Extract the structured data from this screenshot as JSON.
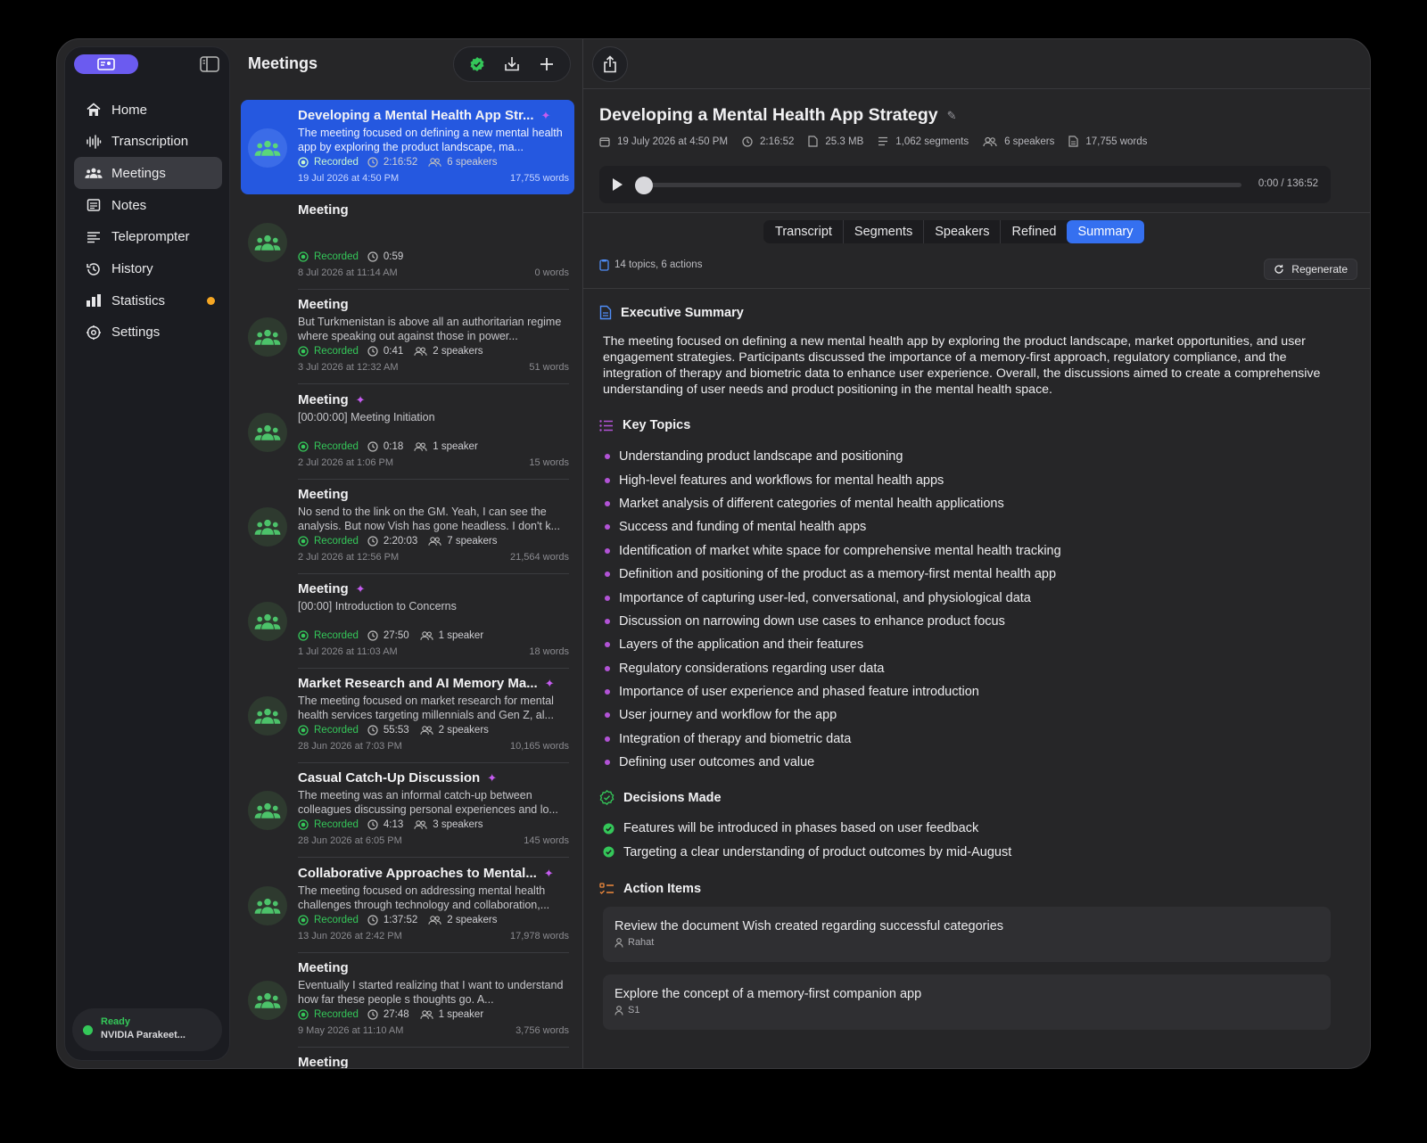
{
  "sidebar": {
    "nav": [
      {
        "label": "Home",
        "icon": "home-icon"
      },
      {
        "label": "Transcription",
        "icon": "waveform-icon"
      },
      {
        "label": "Meetings",
        "icon": "people-icon",
        "active": true
      },
      {
        "label": "Notes",
        "icon": "notes-icon"
      },
      {
        "label": "Teleprompter",
        "icon": "teleprompter-icon"
      },
      {
        "label": "History",
        "icon": "history-icon"
      },
      {
        "label": "Statistics",
        "icon": "chart-icon",
        "badge_color": "#f5a623"
      },
      {
        "label": "Settings",
        "icon": "gear-icon"
      }
    ],
    "status": {
      "title": "Ready",
      "model": "NVIDIA Parakeet..."
    }
  },
  "list": {
    "title": "Meetings",
    "items": [
      {
        "title": "Developing a Mental Health App Str...",
        "ai": true,
        "desc": "The meeting focused on defining a new mental health app by exploring the product landscape, ma...",
        "status": "Recorded",
        "duration": "2:16:52",
        "speakers": "6 speakers",
        "date": "19 Jul 2026 at 4:50 PM",
        "words": "17,755 words"
      },
      {
        "title": "Meeting",
        "ai": false,
        "desc": "",
        "status": "Recorded",
        "duration": "0:59",
        "speakers": "",
        "date": "8 Jul 2026 at 11:14 AM",
        "words": "0 words"
      },
      {
        "title": "Meeting",
        "ai": false,
        "desc": "But Turkmenistan is above all an authoritarian regime where speaking out against those in power...",
        "status": "Recorded",
        "duration": "0:41",
        "speakers": "2 speakers",
        "date": "3 Jul 2026 at 12:32 AM",
        "words": "51 words"
      },
      {
        "title": "Meeting",
        "ai": true,
        "desc": "[00:00:00] Meeting Initiation",
        "status": "Recorded",
        "duration": "0:18",
        "speakers": "1 speaker",
        "date": "2 Jul 2026 at 1:06 PM",
        "words": "15 words"
      },
      {
        "title": "Meeting",
        "ai": false,
        "desc": "No send to the link on the GM. Yeah, I can see the analysis. But now Vish has gone headless. I don't k...",
        "status": "Recorded",
        "duration": "2:20:03",
        "speakers": "7 speakers",
        "date": "2 Jul 2026 at 12:56 PM",
        "words": "21,564 words"
      },
      {
        "title": "Meeting",
        "ai": true,
        "desc": "[00:00] Introduction to Concerns",
        "status": "Recorded",
        "duration": "27:50",
        "speakers": "1 speaker",
        "date": "1 Jul 2026 at 11:03 AM",
        "words": "18 words"
      },
      {
        "title": "Market Research and AI Memory Ma...",
        "ai": true,
        "desc": "The meeting focused on market research for mental health services targeting millennials and Gen Z, al...",
        "status": "Recorded",
        "duration": "55:53",
        "speakers": "2 speakers",
        "date": "28 Jun 2026 at 7:03 PM",
        "words": "10,165 words"
      },
      {
        "title": "Casual Catch-Up Discussion",
        "ai": true,
        "desc": "The meeting was an informal catch-up between colleagues discussing personal experiences and lo...",
        "status": "Recorded",
        "duration": "4:13",
        "speakers": "3 speakers",
        "date": "28 Jun 2026 at 6:05 PM",
        "words": "145 words"
      },
      {
        "title": "Collaborative Approaches to Mental...",
        "ai": true,
        "desc": "The meeting focused on addressing mental health challenges through technology and collaboration,...",
        "status": "Recorded",
        "duration": "1:37:52",
        "speakers": "2 speakers",
        "date": "13 Jun 2026 at 2:42 PM",
        "words": "17,978 words"
      },
      {
        "title": "Meeting",
        "ai": false,
        "desc": "Eventually I started realizing that I want to understand how far these people s thoughts go. A...",
        "status": "Recorded",
        "duration": "27:48",
        "speakers": "1 speaker",
        "date": "9 May 2026 at 11:10 AM",
        "words": "3,756 words"
      },
      {
        "title": "Meeting",
        "ai": false,
        "desc": "",
        "status": "",
        "duration": "",
        "speakers": "",
        "date": "",
        "words": ""
      }
    ]
  },
  "detail": {
    "title": "Developing a Mental Health App Strategy",
    "meta": {
      "date": "19 July 2026 at 4:50 PM",
      "duration": "2:16:52",
      "size": "25.3 MB",
      "segments": "1,062 segments",
      "speakers": "6 speakers",
      "words": "17,755 words"
    },
    "player": {
      "time": "0:00 / 136:52",
      "progress": 0
    },
    "tabs": [
      "Transcript",
      "Segments",
      "Speakers",
      "Refined",
      "Summary"
    ],
    "active_tab": "Summary",
    "summary_stats": "14 topics, 6 actions",
    "regenerate": "Regenerate",
    "exec_title": "Executive Summary",
    "exec_text": "The meeting focused on defining a new mental health app by exploring the product landscape, market opportunities, and user engagement strategies. Participants discussed the importance of a memory-first approach, regulatory compliance, and the integration of therapy and biometric data to enhance user experience. Overall, the discussions aimed to create a comprehensive understanding of user needs and product positioning in the mental health space.",
    "topics_title": "Key Topics",
    "topics": [
      "Understanding product landscape and positioning",
      "High-level features and workflows for mental health apps",
      "Market analysis of different categories of mental health applications",
      "Success and funding of mental health apps",
      "Identification of market white space for comprehensive mental health tracking",
      "Definition and positioning of the product as a memory-first mental health app",
      "Importance of capturing user-led, conversational, and physiological data",
      "Discussion on narrowing down use cases to enhance product focus",
      "Layers of the application and their features",
      "Regulatory considerations regarding user data",
      "Importance of user experience and phased feature introduction",
      "User journey and workflow for the app",
      "Integration of therapy and biometric data",
      "Defining user outcomes and value"
    ],
    "decisions_title": "Decisions Made",
    "decisions": [
      "Features will be introduced in phases based on user feedback",
      "Targeting a clear understanding of product outcomes by mid-August"
    ],
    "actions_title": "Action Items",
    "actions": [
      {
        "title": "Review the document Wish created regarding successful categories",
        "owner": "Rahat"
      },
      {
        "title": "Explore the concept of a memory-first companion app",
        "owner": "S1"
      }
    ]
  },
  "colors": {
    "accent": "#3570f0",
    "selected_row": "#2558e0",
    "recorded": "#34c759",
    "ai_spark": "#c55cf0",
    "profile": "#6b5bf0"
  }
}
